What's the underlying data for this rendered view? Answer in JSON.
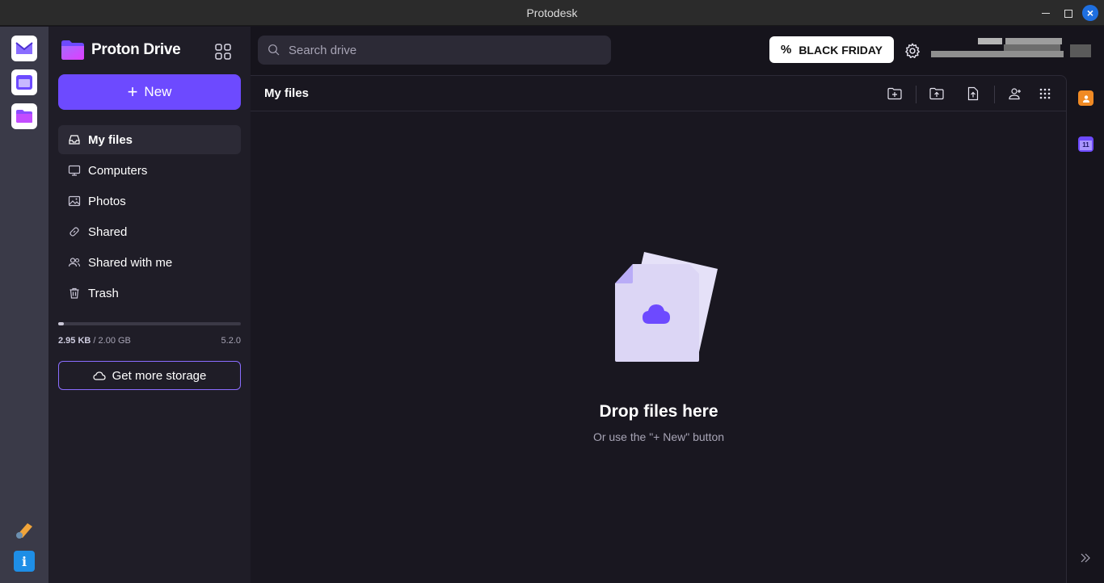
{
  "window": {
    "title": "Protodesk"
  },
  "brand": {
    "name": "Proton Drive",
    "accent": "#6d4aff"
  },
  "sidebar": {
    "new_label": "New",
    "items": [
      {
        "label": "My files",
        "icon": "inbox-icon",
        "active": true
      },
      {
        "label": "Computers",
        "icon": "monitor-icon",
        "active": false
      },
      {
        "label": "Photos",
        "icon": "image-icon",
        "active": false
      },
      {
        "label": "Shared",
        "icon": "link-icon",
        "active": false
      },
      {
        "label": "Shared with me",
        "icon": "users-icon",
        "active": false
      },
      {
        "label": "Trash",
        "icon": "trash-icon",
        "active": false
      }
    ],
    "storage": {
      "used": "2.95 KB",
      "total": "2.00 GB",
      "fraction": 0.03
    },
    "version": "5.2.0",
    "more_storage_label": "Get more storage"
  },
  "topbar": {
    "search_placeholder": "Search drive",
    "promo_label": "BLACK FRIDAY"
  },
  "main": {
    "title": "My files",
    "empty_title": "Drop files here",
    "empty_subtitle": "Or use the \"+ New\" button"
  }
}
